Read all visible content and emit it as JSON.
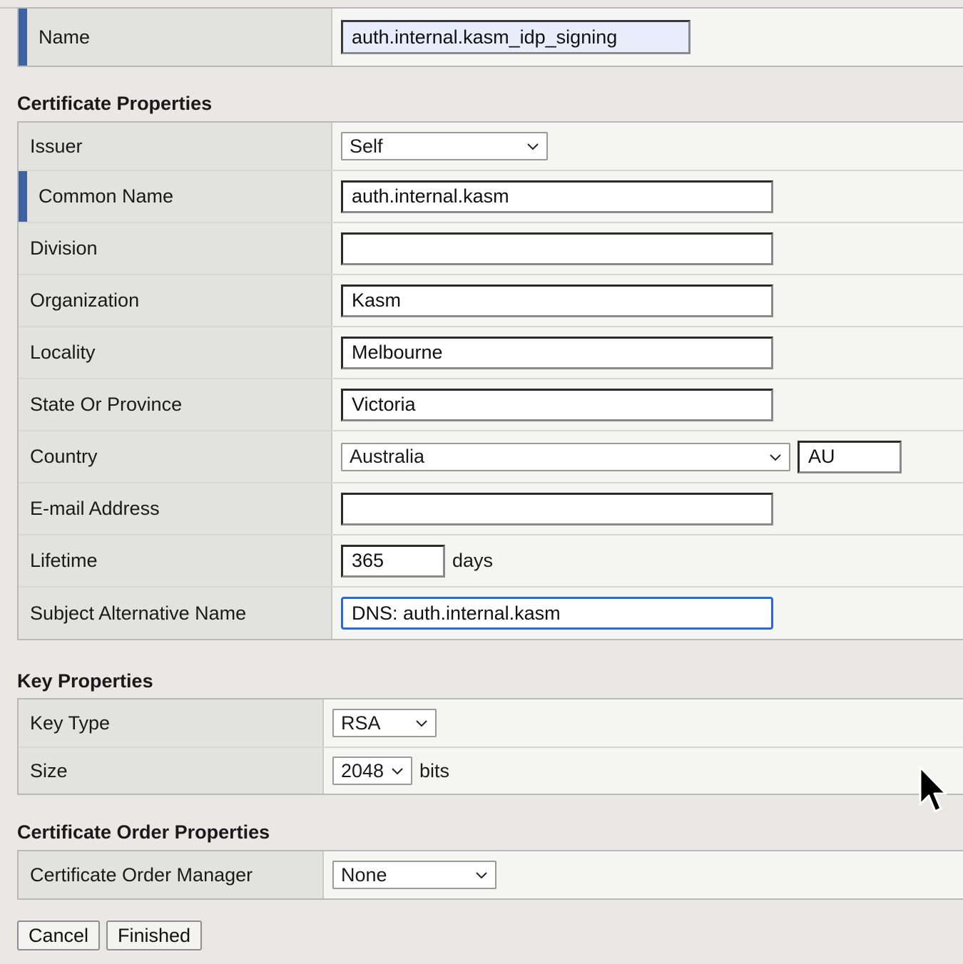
{
  "general": {
    "name_label": "Name",
    "name_value": "auth.internal.kasm_idp_signing"
  },
  "certificate_properties": {
    "heading": "Certificate Properties",
    "issuer_label": "Issuer",
    "issuer_value": "Self",
    "common_name_label": "Common Name",
    "common_name_value": "auth.internal.kasm",
    "division_label": "Division",
    "division_value": "",
    "organization_label": "Organization",
    "organization_value": "Kasm",
    "locality_label": "Locality",
    "locality_value": "Melbourne",
    "state_label": "State Or Province",
    "state_value": "Victoria",
    "country_label": "Country",
    "country_value": "Australia",
    "country_code": "AU",
    "email_label": "E-mail Address",
    "email_value": "",
    "lifetime_label": "Lifetime",
    "lifetime_value": "365",
    "lifetime_unit": "days",
    "san_label": "Subject Alternative Name",
    "san_value": "DNS: auth.internal.kasm"
  },
  "key_properties": {
    "heading": "Key Properties",
    "key_type_label": "Key Type",
    "key_type_value": "RSA",
    "size_label": "Size",
    "size_value": "2048",
    "size_unit": "bits"
  },
  "order_properties": {
    "heading": "Certificate Order Properties",
    "manager_label": "Certificate Order Manager",
    "manager_value": "None"
  },
  "buttons": {
    "cancel": "Cancel",
    "finished": "Finished"
  },
  "colors": {
    "required_marker": "#3e64a0",
    "focus_border": "#2b68d1"
  }
}
